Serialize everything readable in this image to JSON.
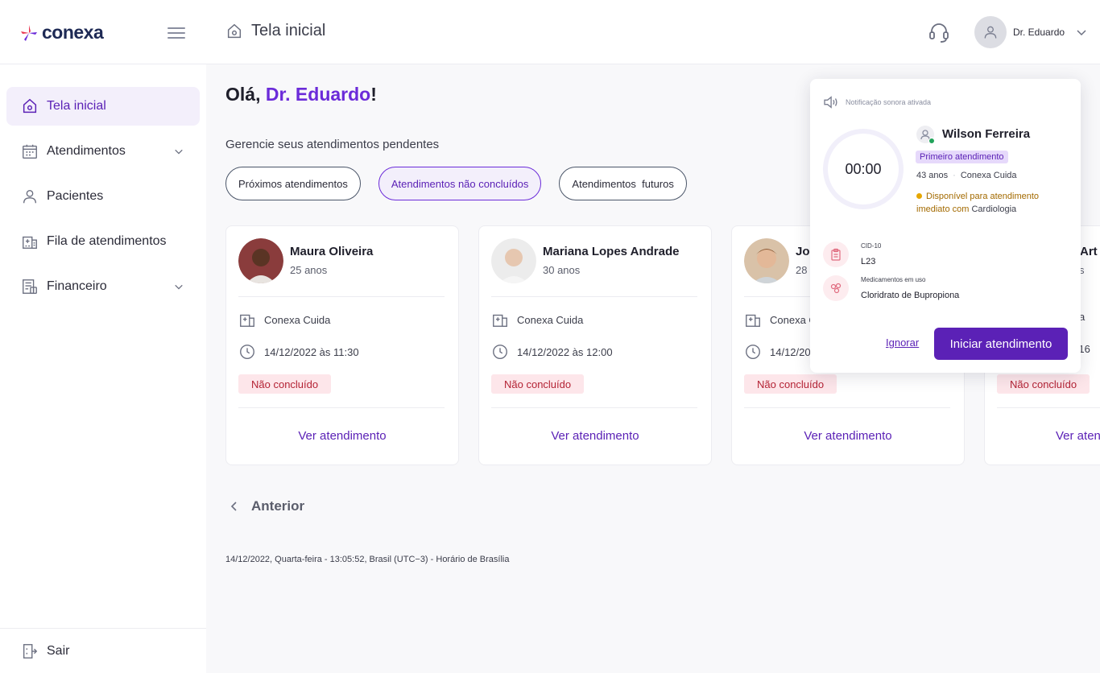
{
  "brand": {
    "name": "conexa"
  },
  "header": {
    "page_title": "Tela inicial",
    "user_name": "Dr. Eduardo"
  },
  "sidebar": {
    "items": [
      {
        "label": "Tela inicial",
        "icon": "home-icon",
        "active": true
      },
      {
        "label": "Atendimentos",
        "icon": "calendar-icon",
        "expandable": true
      },
      {
        "label": "Pacientes",
        "icon": "user-icon"
      },
      {
        "label": "Fila de atendimentos",
        "icon": "building-icon"
      },
      {
        "label": "Financeiro",
        "icon": "invoice-icon",
        "expandable": true
      }
    ],
    "logout_label": "Sair"
  },
  "main": {
    "greeting_prefix": "Olá,",
    "greeting_name": "Dr. Eduardo",
    "greeting_suffix": "!",
    "subtitle": "Gerencie seus atendimentos pendentes",
    "filters": [
      {
        "label": "Próximos atendimentos",
        "active": false
      },
      {
        "label": "Atendimentos não concluídos",
        "active": true
      },
      {
        "label": "Atendimentos  futuros",
        "active": false
      }
    ],
    "cards": [
      {
        "name": "Maura Oliveira",
        "age": "25 anos",
        "clinic": "Conexa Cuida",
        "datetime": "14/12/2022 às 11:30",
        "status": "Não concluído",
        "link": "Ver atendimento"
      },
      {
        "name": "Mariana Lopes Andrade",
        "age": "30 anos",
        "clinic": "Conexa Cuida",
        "datetime": "14/12/2022 às 12:00",
        "status": "Não concluído",
        "link": "Ver atendimento"
      },
      {
        "name": "Jo",
        "age": "28 a",
        "clinic": "Conexa C",
        "datetime": "14/12/20",
        "status": "Não concluído",
        "link": "Ver atendimento"
      },
      {
        "name": "Art",
        "age": "s",
        "clinic": "a",
        "datetime": "às 16",
        "status": "Não concluído",
        "link": "Ver aten"
      }
    ],
    "pager_label": "Anterior",
    "footer_time": "14/12/2022, Quarta-feira - 13:05:52, Brasil (UTC−3) - Horário de Brasília"
  },
  "popup": {
    "sound_label": "Notificação sonora ativada",
    "timer": "00:00",
    "patient_name": "Wilson Ferreira",
    "badge": "Primeiro atendimento",
    "age": "43 anos",
    "clinic": "Conexa Cuida",
    "availability": "Disponível para atendimento imediato com",
    "specialty": "Cardiologia",
    "cid_label": "CID-10",
    "cid_value": "L23",
    "meds_label": "Medicamentos em uso",
    "meds_value": "Cloridrato de Bupropiona",
    "ignore_label": "Ignorar",
    "start_label": "Iniciar atendimento"
  },
  "colors": {
    "brand": "#5b21b6",
    "accent": "#6b2bd9",
    "danger": "#b42335",
    "danger_bg": "#fde6ea",
    "success": "#21a35a",
    "warning": "#e6a700"
  }
}
